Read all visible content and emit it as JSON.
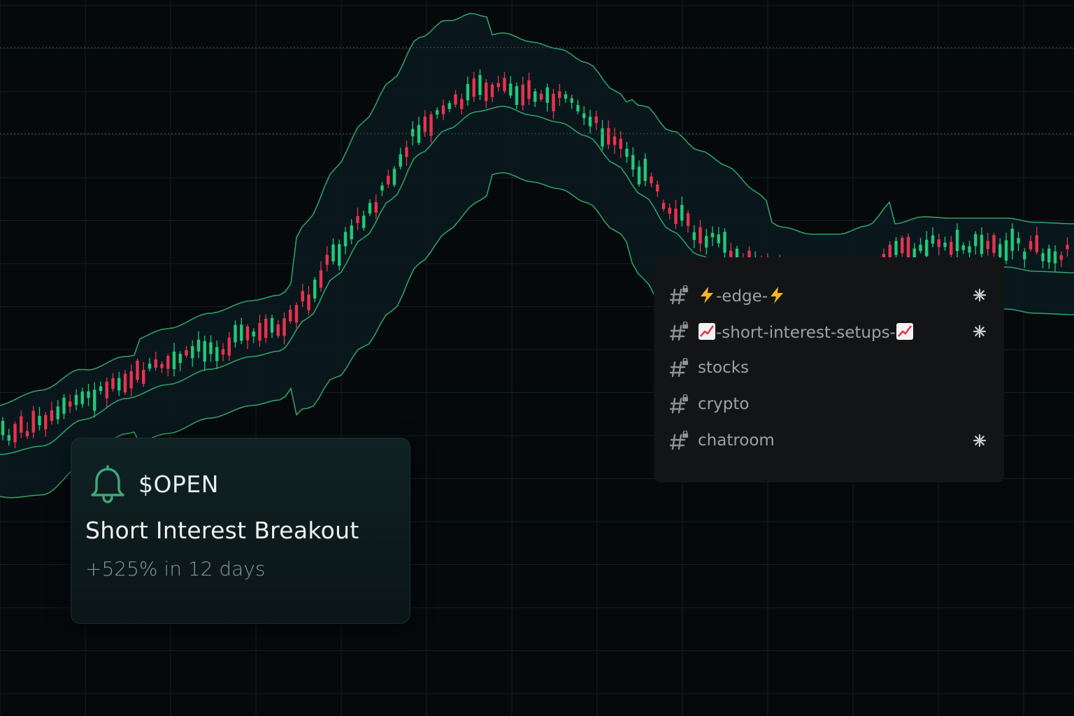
{
  "colors": {
    "background": "#05090b",
    "grid": "#122023",
    "band": "#2f9e66",
    "band_fill": "#0b1a20",
    "up": "#22c87a",
    "down": "#e8334f",
    "guide": "#3a5a50"
  },
  "alert_card": {
    "icon": "bell-icon",
    "ticker": "$OPEN",
    "headline": "Short Interest Breakout",
    "subtext": "+525% in 12 days"
  },
  "channels": [
    {
      "icon": "hash-lock-icon",
      "prefix_emoji": "lightning-icon",
      "name": "-edge-",
      "suffix_emoji": "lightning-icon",
      "starred": true
    },
    {
      "icon": "hash-lock-icon",
      "prefix_emoji": "chart-up-icon",
      "name": "-short-interest-setups-",
      "suffix_emoji": "chart-up-icon",
      "starred": true
    },
    {
      "icon": "hash-lock-icon",
      "name": "stocks",
      "starred": false
    },
    {
      "icon": "hash-lock-icon",
      "name": "crypto",
      "starred": false
    },
    {
      "icon": "hash-lock-icon",
      "name": "chatroom",
      "starred": true
    }
  ],
  "chart_data": {
    "type": "candlestick",
    "indicators": [
      "bollinger-bands"
    ],
    "grid": true,
    "horizontal_guides": 2,
    "candle_count": 176,
    "trend": "rally, peak, pullback, recovery"
  }
}
